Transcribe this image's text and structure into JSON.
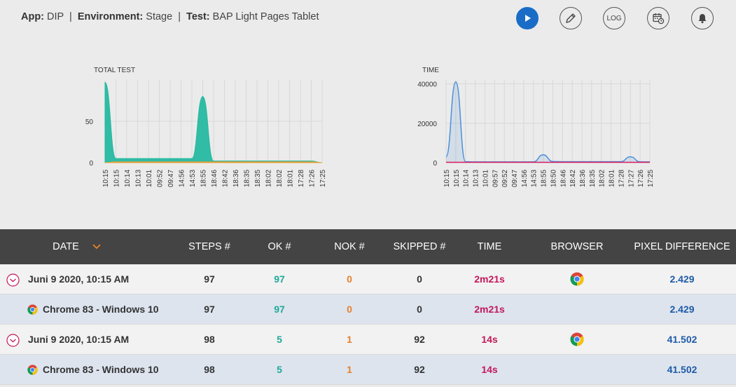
{
  "context": {
    "app_label": "App:",
    "app_value": "DIP",
    "env_label": "Environment:",
    "env_value": "Stage",
    "test_label": "Test:",
    "test_value": "BAP Light Pages Tablet",
    "separator": "|"
  },
  "toolbar": {
    "play": "play-icon",
    "edit": "pencil-icon",
    "log_label": "LOG",
    "calendar": "calendar-clock-icon",
    "bell": "bell-icon"
  },
  "colors": {
    "accent": "#1a6dc7",
    "ok": "#1fa99a",
    "nok": "#e7812a",
    "time": "#c2185b",
    "pixel": "#1e5ba8",
    "header_bg": "#444444",
    "sort_arrow": "#e7812a"
  },
  "chart_data": [
    {
      "type": "area",
      "title": "TOTAL TEST",
      "x": [
        "10:15",
        "10:15",
        "10:14",
        "10:13",
        "10:01",
        "09:52",
        "09:47",
        "14:56",
        "14:53",
        "18:55",
        "18:46",
        "18:42",
        "18:36",
        "18:35",
        "18:35",
        "18:02",
        "18:02",
        "18:01",
        "17:28",
        "17:26",
        "17:25"
      ],
      "yticks": [
        0,
        50
      ],
      "ylim": [
        0,
        100
      ],
      "grid": true,
      "series": [
        {
          "color": "#26b9a1",
          "values": [
            97,
            5,
            5,
            5,
            5,
            5,
            5,
            5,
            5,
            80,
            2,
            2,
            2,
            2,
            2,
            2,
            2,
            2,
            2,
            2,
            0
          ]
        },
        {
          "color": "#e7a032",
          "values": [
            0,
            1,
            1,
            1,
            1,
            1,
            1,
            1,
            1,
            1,
            1,
            1,
            1,
            1,
            1,
            1,
            1,
            1,
            1,
            1,
            0
          ]
        }
      ]
    },
    {
      "type": "line",
      "title": "TIME",
      "x": [
        "10:15",
        "10:15",
        "10:14",
        "10:13",
        "10:01",
        "09:57",
        "09:52",
        "09:47",
        "14:56",
        "14:53",
        "18:55",
        "18:50",
        "18:46",
        "18:42",
        "18:36",
        "18:35",
        "18:02",
        "18:01",
        "17:28",
        "17:27",
        "17:26",
        "17:25"
      ],
      "yticks": [
        0,
        20000,
        40000
      ],
      "ylim": [
        0,
        42000
      ],
      "grid": true,
      "series": [
        {
          "color": "#4a90d9",
          "values": [
            3000,
            41000,
            500,
            400,
            400,
            400,
            400,
            400,
            400,
            400,
            4000,
            600,
            500,
            500,
            500,
            500,
            500,
            500,
            500,
            3000,
            400,
            400
          ]
        },
        {
          "color": "#d81b60",
          "values": [
            200,
            200,
            200,
            200,
            200,
            200,
            200,
            200,
            200,
            200,
            200,
            200,
            200,
            200,
            200,
            200,
            200,
            200,
            200,
            200,
            200,
            200
          ]
        }
      ]
    }
  ],
  "table": {
    "headers": {
      "date": "DATE",
      "steps": "STEPS #",
      "ok": "OK #",
      "nok": "NOK #",
      "skipped": "SKIPPED #",
      "time": "TIME",
      "browser": "BROWSER",
      "pixel": "PIXEL DIFFERENCE"
    },
    "rows": [
      {
        "date": "Juni 9 2020, 10:15 AM",
        "steps": "97",
        "ok": "97",
        "nok": "0",
        "skipped": "0",
        "time": "2m21s",
        "pixel": "2.429"
      },
      {
        "date": "Chrome 83 - Windows 10",
        "steps": "97",
        "ok": "97",
        "nok": "0",
        "skipped": "0",
        "time": "2m21s",
        "pixel": "2.429"
      },
      {
        "date": "Juni 9 2020, 10:15 AM",
        "steps": "98",
        "ok": "5",
        "nok": "1",
        "skipped": "92",
        "time": "14s",
        "pixel": "41.502"
      },
      {
        "date": "Chrome 83 - Windows 10",
        "steps": "98",
        "ok": "5",
        "nok": "1",
        "skipped": "92",
        "time": "14s",
        "pixel": "41.502"
      }
    ]
  }
}
